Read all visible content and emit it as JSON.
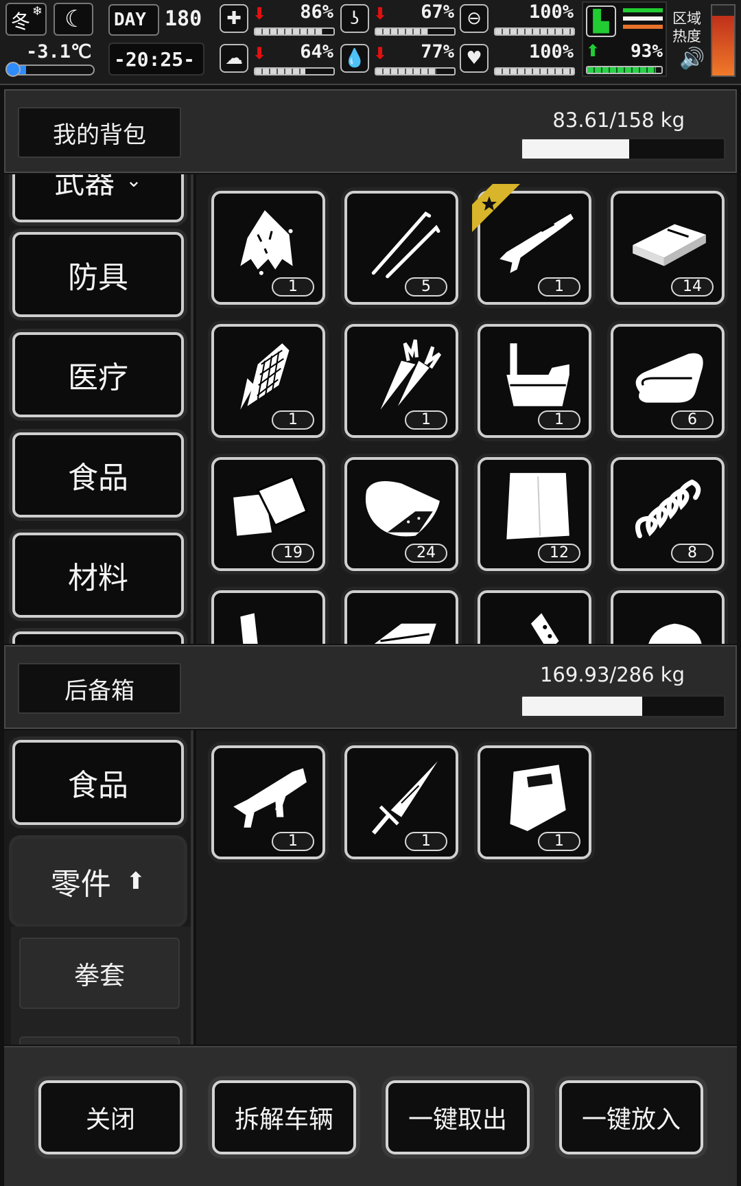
{
  "status": {
    "season": "冬",
    "temperature": "-3.1℃",
    "temperature_fraction": 0.2,
    "day_label": "DAY",
    "day_number": "180",
    "clock": "-20:25-",
    "stats": [
      {
        "icon": "medkit-icon",
        "trend": "down",
        "value": "86%",
        "fraction": 0.86
      },
      {
        "icon": "stomach-icon",
        "trend": "down",
        "value": "67%",
        "fraction": 0.67
      },
      {
        "icon": "bandage-icon",
        "trend": "none",
        "value": "100%",
        "fraction": 1.0
      },
      {
        "icon": "brain-icon",
        "trend": "down",
        "value": "64%",
        "fraction": 0.64
      },
      {
        "icon": "water-drop-icon",
        "trend": "down",
        "value": "77%",
        "fraction": 0.77
      },
      {
        "icon": "heart-icon",
        "trend": "none",
        "value": "100%",
        "fraction": 1.0
      }
    ],
    "stamina": {
      "icon": "boot-icon",
      "trend": "up",
      "value": "93%",
      "fraction": 0.93
    },
    "zone_heat_label_1": "区域",
    "zone_heat_label_2": "热度",
    "zone_heat_fraction": 0.85,
    "colors": {
      "down": "#e01010",
      "up": "#22cc33",
      "heat": "#e8561c"
    }
  },
  "backpack": {
    "title": "我的背包",
    "weight": "83.61/158 kg",
    "weight_fraction": 0.529,
    "categories": [
      {
        "label": "武器",
        "icon": "chevron-down-icon"
      },
      {
        "label": "防具"
      },
      {
        "label": "医疗"
      },
      {
        "label": "食品"
      },
      {
        "label": "材料"
      }
    ],
    "items": [
      {
        "name": "rag-cloth",
        "count": "1"
      },
      {
        "name": "lockpick",
        "count": "5"
      },
      {
        "name": "shotgun",
        "count": "1",
        "starred": true
      },
      {
        "name": "metal-plate",
        "count": "14"
      },
      {
        "name": "corn",
        "count": "1"
      },
      {
        "name": "carrot",
        "count": "1"
      },
      {
        "name": "water-bucket",
        "count": "1"
      },
      {
        "name": "cloth-roll",
        "count": "6"
      },
      {
        "name": "leather-scrap",
        "count": "19"
      },
      {
        "name": "raw-meat",
        "count": "24"
      },
      {
        "name": "paper-sheet",
        "count": "12"
      },
      {
        "name": "spring",
        "count": "8"
      },
      {
        "name": "item-13"
      },
      {
        "name": "item-14"
      },
      {
        "name": "item-15"
      },
      {
        "name": "item-16"
      }
    ]
  },
  "trunk": {
    "title": "后备箱",
    "weight": "169.93/286 kg",
    "weight_fraction": 0.594,
    "categories": [
      {
        "label": "食品"
      },
      {
        "label": "零件",
        "active": true,
        "icon": "arrow-up-icon"
      }
    ],
    "subcategories": [
      {
        "label": "拳套"
      }
    ],
    "items": [
      {
        "name": "smg",
        "count": "1"
      },
      {
        "name": "dagger",
        "count": "1"
      },
      {
        "name": "riot-shield",
        "count": "1"
      }
    ]
  },
  "actions": {
    "close": "关闭",
    "dismantle": "拆解车辆",
    "take_all": "一键取出",
    "put_all": "一键放入"
  }
}
